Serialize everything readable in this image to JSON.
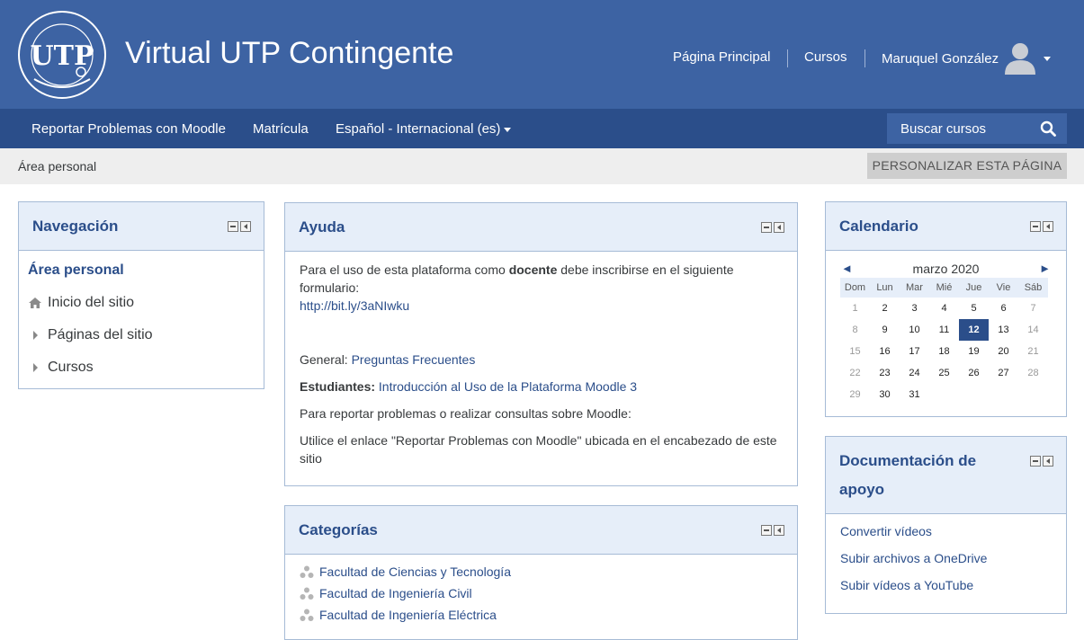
{
  "header": {
    "site_title": "Virtual UTP Contingente",
    "nav": [
      "Página Principal",
      "Cursos"
    ],
    "user_name": "Maruquel González"
  },
  "navbar": {
    "items": [
      "Reportar Problemas con Moodle",
      "Matrícula",
      "Español - Internacional (es)"
    ],
    "search_label": "Buscar cursos"
  },
  "breadcrumb": {
    "current": "Área personal",
    "customize_button": "PERSONALIZAR ESTA PÁGINA"
  },
  "navigation_block": {
    "title": "Navegación",
    "items": [
      "Área personal",
      "Inicio del sitio",
      "Páginas del sitio",
      "Cursos"
    ]
  },
  "help_block": {
    "title": "Ayuda",
    "intro_prefix": "Para el uso de esta plataforma como ",
    "intro_bold": "docente",
    "intro_suffix": " debe inscribirse en el siguiente formulario:",
    "form_link": "http://bit.ly/3aNIwku",
    "general_label": "General: ",
    "general_link": "Preguntas Frecuentes",
    "students_label": "Estudiantes:",
    "students_link": "Introducción al Uso de la Plataforma Moodle 3",
    "report_text": "Para reportar problemas o realizar consultas sobre Moodle:",
    "report_instructions": "Utilice el enlace \"Reportar Problemas con Moodle\" ubicada en el encabezado de este sitio"
  },
  "categories_block": {
    "title": "Categorías",
    "items": [
      "Facultad de Ciencias y Tecnología",
      "Facultad de Ingeniería Civil",
      "Facultad de Ingeniería Eléctrica"
    ]
  },
  "calendar_block": {
    "title": "Calendario",
    "month": "marzo 2020",
    "prev": "◄",
    "next": "►",
    "days": [
      "Dom",
      "Lun",
      "Mar",
      "Mié",
      "Jue",
      "Vie",
      "Sáb"
    ],
    "weeks": [
      [
        "1",
        "2",
        "3",
        "4",
        "5",
        "6",
        "7"
      ],
      [
        "8",
        "9",
        "10",
        "11",
        "12",
        "13",
        "14"
      ],
      [
        "15",
        "16",
        "17",
        "18",
        "19",
        "20",
        "21"
      ],
      [
        "22",
        "23",
        "24",
        "25",
        "26",
        "27",
        "28"
      ],
      [
        "29",
        "30",
        "31",
        "",
        "",
        "",
        ""
      ]
    ],
    "today": "12"
  },
  "docs_block": {
    "title_line1": "Documentación de",
    "title_line2": "apoyo",
    "items": [
      "Convertir vídeos",
      "Subir archivos a OneDrive",
      "Subir vídeos a YouTube"
    ]
  },
  "colors": {
    "header_bg": "#3d63a3",
    "navbar_bg": "#2b4e8a",
    "block_header_bg": "#e6eef9",
    "link": "#2b4e8a"
  }
}
